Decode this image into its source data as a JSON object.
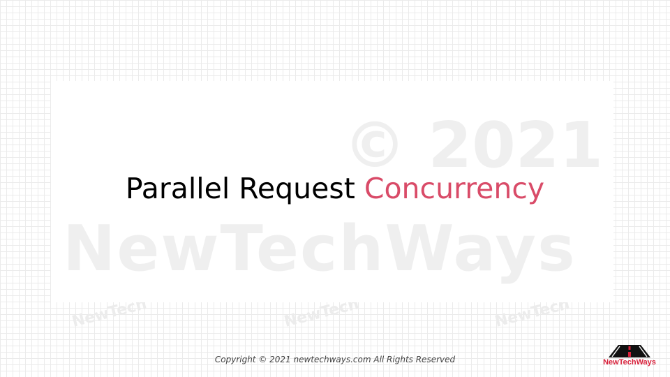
{
  "slide": {
    "title_part1": "Parallel Request ",
    "title_accent": "Concurrency",
    "accent_color": "#d94b68"
  },
  "watermark": {
    "year": "© 2021",
    "brand": "NewTechWays",
    "small": "NewTech"
  },
  "footer": {
    "copyright": "Copyright © 2021 newtechways.com All Rights Reserved"
  },
  "logo": {
    "text": "NewTechWays",
    "icon": "road-perspective-icon",
    "color": "#d8213b"
  }
}
